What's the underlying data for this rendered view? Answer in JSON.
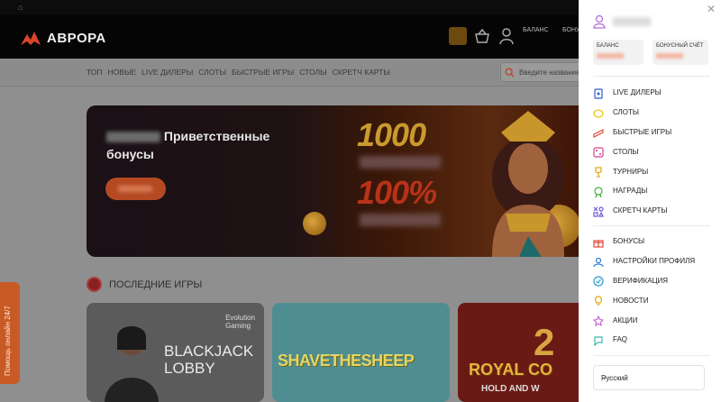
{
  "header": {
    "brand": "АВРОРА",
    "balance_label": "БАЛАНС",
    "bonus_label": "БОНУС"
  },
  "nav": {
    "items": [
      "ТОП",
      "НОВЫЕ",
      "LIVE ДИЛЕРЫ",
      "СЛОТЫ",
      "БЫСТРЫЕ ИГРЫ",
      "СТОЛЫ",
      "СКРЕТЧ КАРТЫ"
    ],
    "search_placeholder": "Введите название"
  },
  "banner": {
    "title_word": "Приветственные",
    "title_line2": "бонусы",
    "promo_1": "1000",
    "promo_2": "100%"
  },
  "recent": {
    "title": "ПОСЛЕДНИЕ ИГРЫ",
    "games": [
      {
        "brand_line1": "Evolution",
        "brand_line2": "Gaming",
        "title_line1": "BLACKJACK",
        "title_line2": "LOBBY"
      },
      {
        "title": "SHAVETHESHEEP"
      },
      {
        "number": "2",
        "title": "ROYAL CO",
        "subtitle": "HOLD AND W"
      }
    ]
  },
  "help": {
    "label": "Помощь онлайн 24/7"
  },
  "panel": {
    "balance_label": "БАЛАНС",
    "bonus_label": "БОНУСНЫЙ СЧЁТ",
    "menu_games": [
      {
        "icon": "live-dealer-icon",
        "label": "LIVE ДИЛЕРЫ",
        "color": "#2a5bd7"
      },
      {
        "icon": "slots-icon",
        "label": "СЛОТЫ",
        "color": "#e5c400"
      },
      {
        "icon": "fast-games-icon",
        "label": "БЫСТРЫЕ ИГРЫ",
        "color": "#e0483a"
      },
      {
        "icon": "tables-icon",
        "label": "СТОЛЫ",
        "color": "#d63f8c"
      },
      {
        "icon": "tournaments-icon",
        "label": "ТУРНИРЫ",
        "color": "#e0a800"
      },
      {
        "icon": "rewards-icon",
        "label": "НАГРАДЫ",
        "color": "#3cae3c"
      },
      {
        "icon": "scratch-cards-icon",
        "label": "СКРЕТЧ КАРТЫ",
        "color": "#6b5bd7"
      }
    ],
    "menu_account": [
      {
        "icon": "bonus-icon",
        "label": "БОНУСЫ",
        "color": "#e0483a"
      },
      {
        "icon": "profile-settings-icon",
        "label": "НАСТРОЙКИ ПРОФИЛЯ",
        "color": "#2a7bd7"
      },
      {
        "icon": "verification-icon",
        "label": "ВЕРИФИКАЦИЯ",
        "color": "#2a9bd7"
      },
      {
        "icon": "news-icon",
        "label": "НОВОСТИ",
        "color": "#e0a800"
      },
      {
        "icon": "promo-icon",
        "label": "АКЦИИ",
        "color": "#c45bd7"
      },
      {
        "icon": "faq-icon",
        "label": "FAQ",
        "color": "#3cb8a8"
      }
    ],
    "language": "Русский"
  }
}
